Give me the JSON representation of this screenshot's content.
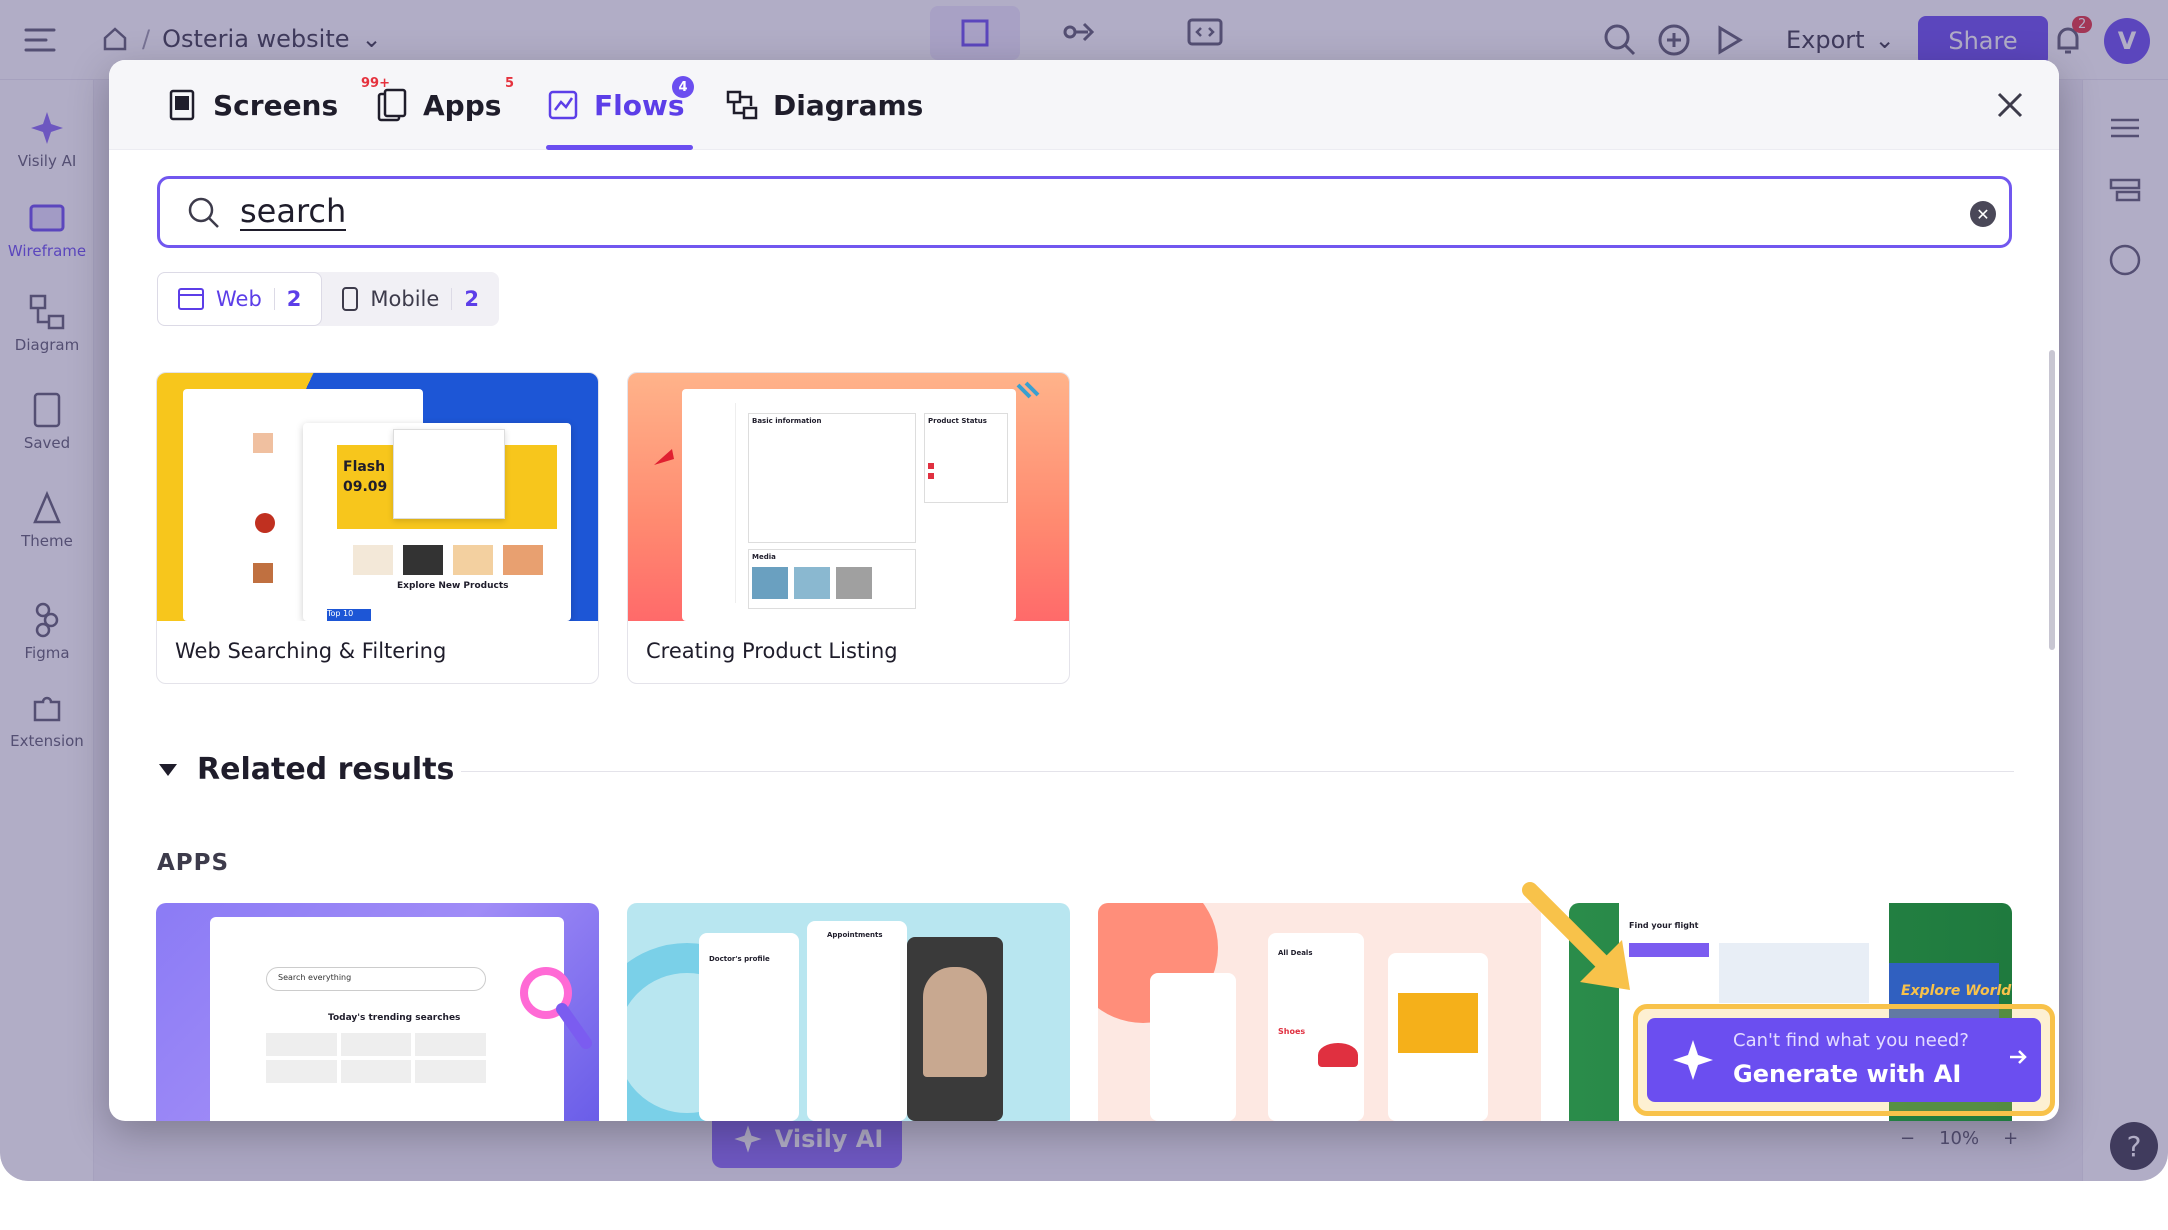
{
  "app": {
    "breadcrumb_project": "Osteria website",
    "left_rail": [
      {
        "label": "Visily AI",
        "icon": "sparkle-icon"
      },
      {
        "label": "Wireframe",
        "icon": "wireframe-icon"
      },
      {
        "label": "Diagram",
        "icon": "diagram-icon"
      },
      {
        "label": "Saved",
        "icon": "saved-icon"
      },
      {
        "label": "Theme",
        "icon": "theme-icon"
      },
      {
        "label": "Figma",
        "icon": "figma-icon"
      },
      {
        "label": "Extension",
        "icon": "extension-icon"
      }
    ],
    "top_tabs": [
      "DESIGN",
      "PROTOTYPE",
      "INSPECT"
    ],
    "export_label": "Export",
    "share_label": "Share",
    "notification_count": "2",
    "avatar_letter": "V",
    "visily_ai_button": "Visily AI",
    "zoom_level": "10%",
    "help_label": "?"
  },
  "modal": {
    "tabs": [
      {
        "label": "Screens",
        "badge": "99+"
      },
      {
        "label": "Apps",
        "badge": "5"
      },
      {
        "label": "Flows",
        "badge": "4"
      },
      {
        "label": "Diagrams",
        "badge": ""
      }
    ],
    "active_tab": "Flows",
    "search": {
      "value": "search"
    },
    "filters": [
      {
        "label": "Web",
        "count": "2"
      },
      {
        "label": "Mobile",
        "count": "2"
      }
    ],
    "results": [
      {
        "title": "Web Searching & Filtering"
      },
      {
        "title": "Creating Product Listing"
      }
    ],
    "related_title": "Related results",
    "apps_label": "APPS",
    "thumb_text": {
      "result1_banner": "Flash",
      "result1_date": "09.09",
      "result1_top": "Top 10",
      "result1_explore": "Explore New Products",
      "result2_section": "Basic information",
      "result2_status": "Product Status",
      "result2_media": "Media",
      "app1_search": "Search everything",
      "app1_trending": "Today's trending searches",
      "app2_title": "Appointments",
      "app2_profile": "Doctor's profile",
      "app3_label": "All Deals",
      "app3_shoes": "Shoes",
      "app4_flight": "Find your flight",
      "app4_world": "Explore World"
    },
    "generate_ai": {
      "prompt": "Can't find what you need?",
      "action": "Generate with AI"
    }
  },
  "colors": {
    "accent": "#6b4ef0",
    "highlight": "#f8c24a",
    "badge_red": "#e5323e"
  }
}
